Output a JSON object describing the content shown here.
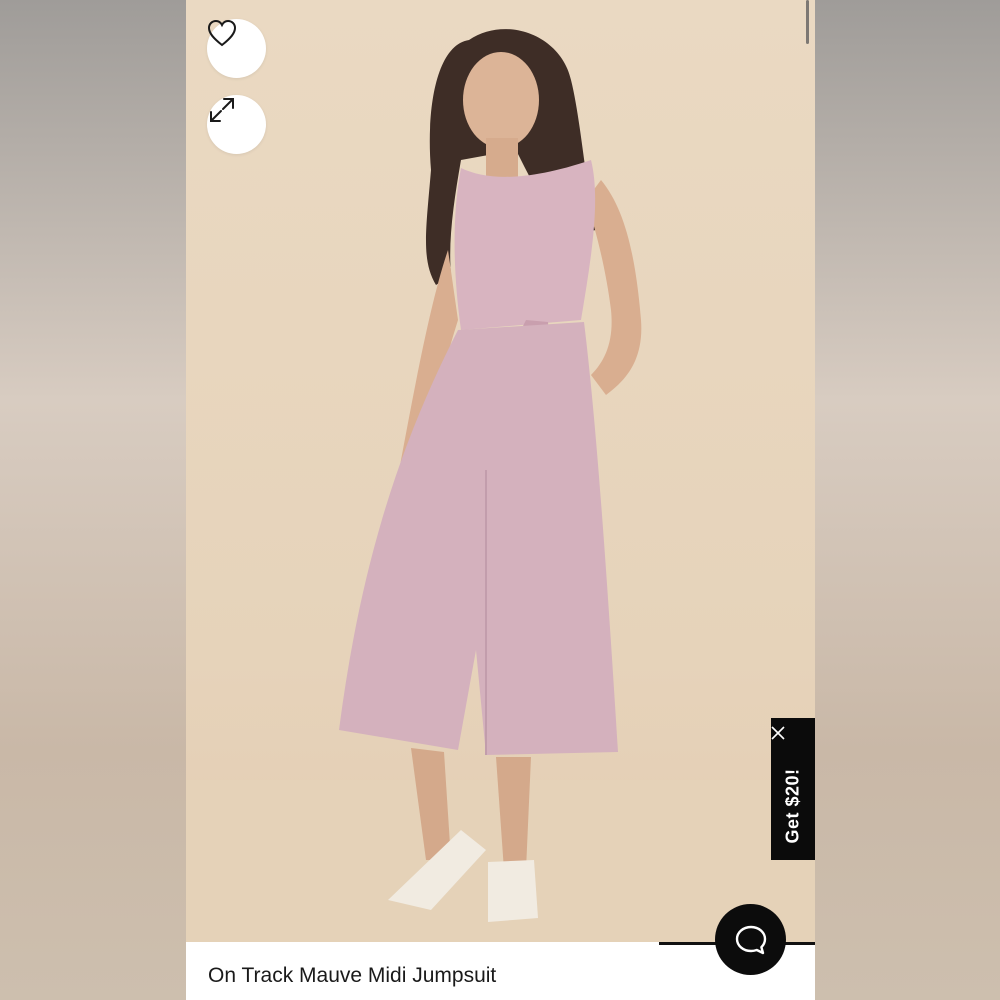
{
  "product": {
    "title": "On Track Mauve Midi Jumpsuit"
  },
  "actions": {
    "favorite_icon": "heart-icon",
    "expand_icon": "expand-arrows-icon"
  },
  "promo": {
    "label": "Get $20!",
    "close_icon": "close-x-icon"
  },
  "chat": {
    "icon": "chat-bubble-icon"
  },
  "colors": {
    "backdrop": "#e8d6be",
    "jumpsuit": "#d4b1bd",
    "dark": "#0b0b0b"
  }
}
